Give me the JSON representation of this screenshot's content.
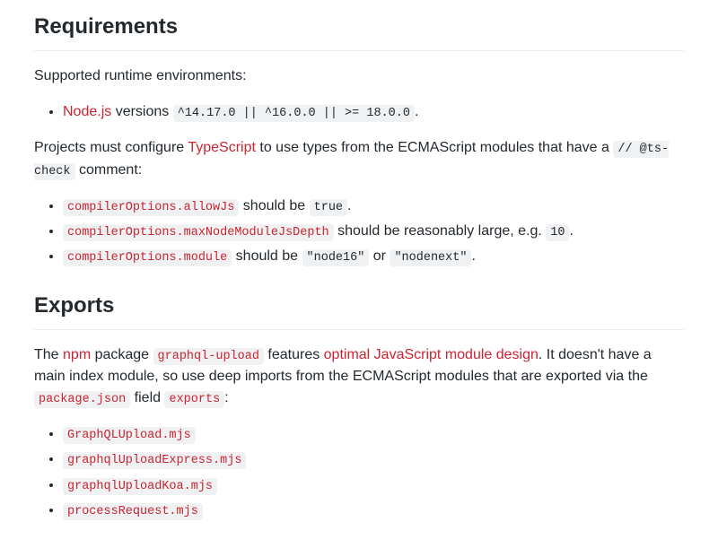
{
  "requirements": {
    "heading": "Requirements",
    "intro": "Supported runtime environments:",
    "nodeItem": {
      "link": "Node.js",
      "text": " versions ",
      "versions": "^14.17.0 || ^16.0.0 || >= 18.0.0",
      "period": "."
    },
    "tsIntro": {
      "p1": "Projects must configure ",
      "link": "TypeScript",
      "p2": " to use types from the ECMAScript modules that have a ",
      "comment": "// @ts-check",
      "p3": " comment:"
    },
    "tsOptions": [
      {
        "option": "compilerOptions.allowJs",
        "text1": " should be ",
        "value": "true",
        "text2": "."
      },
      {
        "option": "compilerOptions.maxNodeModuleJsDepth",
        "text1": " should be reasonably large, e.g. ",
        "value": "10",
        "text2": "."
      },
      {
        "option": "compilerOptions.module",
        "text1": " should be ",
        "value": "\"node16\"",
        "mid": " or ",
        "value2": "\"nodenext\"",
        "text2": "."
      }
    ]
  },
  "exports": {
    "heading": "Exports",
    "intro": {
      "p1": "The ",
      "link1": "npm",
      "p2": " package ",
      "pkg": "graphql-upload",
      "p3": " features ",
      "link2": "optimal JavaScript module design",
      "p4": ". It doesn't have a main index module, so use deep imports from the ECMAScript modules that are exported via the ",
      "pkgjson": "package.json",
      "p5": " field ",
      "exportsField": "exports",
      "p6": ":"
    },
    "files": [
      "GraphQLUpload.mjs",
      "graphqlUploadExpress.mjs",
      "graphqlUploadKoa.mjs",
      "processRequest.mjs"
    ]
  }
}
